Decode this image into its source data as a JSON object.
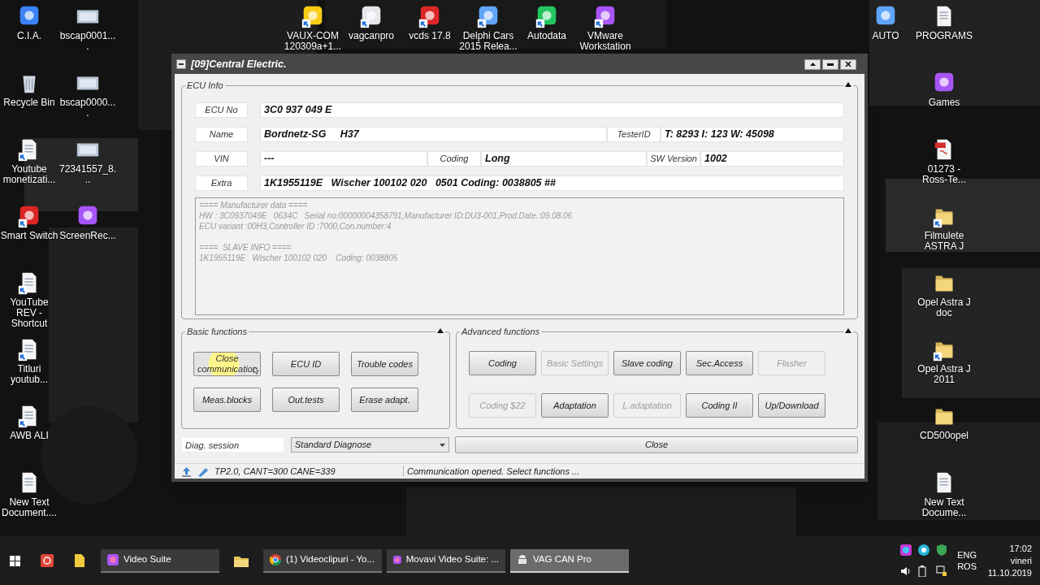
{
  "desktop": {
    "left_column": [
      {
        "label": "C.I.A.",
        "kind": "app",
        "shortcut": false
      },
      {
        "label": "Recycle Bin",
        "kind": "bin",
        "shortcut": false
      },
      {
        "label": "Youtube monetizati...",
        "kind": "document",
        "shortcut": true
      },
      {
        "label": "Smart Switch",
        "kind": "app",
        "shortcut": true
      },
      {
        "label": "YouTube REV - Shortcut",
        "kind": "document",
        "shortcut": true
      },
      {
        "label": "Titluri youtub...",
        "kind": "document",
        "shortcut": true
      },
      {
        "label": "AWB ALI",
        "kind": "document",
        "shortcut": true
      },
      {
        "label": "New Text Document....",
        "kind": "document",
        "shortcut": false
      }
    ],
    "second_column": [
      {
        "label": "bscap0001....",
        "kind": "thumbnail",
        "shortcut": false
      },
      {
        "label": "bscap0000....",
        "kind": "thumbnail",
        "shortcut": false
      },
      {
        "label": "72341557_8...",
        "kind": "thumbnail",
        "shortcut": false
      },
      {
        "label": "ScreenRec...",
        "kind": "app",
        "shortcut": false
      }
    ],
    "top_row": [
      {
        "label": "VAUX-COM 120309a+1...",
        "kind": "app",
        "shortcut": true
      },
      {
        "label": "vagcanpro",
        "kind": "app",
        "shortcut": true
      },
      {
        "label": "vcds 17.8",
        "kind": "app",
        "shortcut": true
      },
      {
        "label": "Delphi Cars 2015 Relea...",
        "kind": "app",
        "shortcut": true
      },
      {
        "label": "Autodata",
        "kind": "app",
        "shortcut": true
      },
      {
        "label": "VMware Workstation",
        "kind": "app",
        "shortcut": true
      }
    ],
    "auto_column": [
      {
        "label": "AUTO",
        "kind": "app",
        "shortcut": false
      }
    ],
    "right_column": [
      {
        "label": "PROGRAMS",
        "kind": "document",
        "shortcut": false
      },
      {
        "label": "Games",
        "kind": "app",
        "shortcut": false
      },
      {
        "label": "01273 - Ross-Te...",
        "kind": "pdf",
        "shortcut": false
      },
      {
        "label": "Filmulete ASTRA J",
        "kind": "folder",
        "shortcut": true
      },
      {
        "label": "Opel Astra J doc",
        "kind": "folder",
        "shortcut": false
      },
      {
        "label": "Opel Astra J 2011",
        "kind": "folder",
        "shortcut": true
      },
      {
        "label": "CD500opel",
        "kind": "folder",
        "shortcut": false
      },
      {
        "label": "New Text Docume...",
        "kind": "document",
        "shortcut": false
      }
    ]
  },
  "window": {
    "title": "[09]Central Electric.",
    "ecu_info": {
      "title": "ECU Info",
      "ecu_no": {
        "label": "ECU No",
        "value": "3C0 937 049 E"
      },
      "name": {
        "label": "Name",
        "value": "Bordnetz-SG     H37"
      },
      "tester_id": {
        "label": "TesterID",
        "value": "T: 8293 I: 123 W: 45098"
      },
      "vin": {
        "label": "VIN",
        "value": "---"
      },
      "coding": {
        "label": "Coding",
        "value": "Long"
      },
      "sw_version": {
        "label": "SW Version",
        "value": "1002"
      },
      "extra": {
        "label": "Extra",
        "value": "1K1955119E   Wischer 100102 020   0501 Coding: 0038805 ##"
      },
      "details": [
        [
          "==== Manufacturer data ====",
          "HW : 3C0937049E   0634C   Serial no:00000004358791,Manufacturer ID:DU3-001,Prod.Date.:09.08.06",
          "ECU variant :00H3,Controller ID :7000,Con.number:4"
        ],
        [
          "====  SLAVE INFO ====",
          "1K1955119E   Wischer 100102 020    Coding: 0038805"
        ]
      ]
    },
    "basic_functions": {
      "title": "Basic functions",
      "buttons": [
        {
          "label": "Close communication",
          "disabled": false,
          "hovered": true
        },
        {
          "label": "ECU ID",
          "disabled": false,
          "hovered": false
        },
        {
          "label": "Trouble codes",
          "disabled": false,
          "hovered": false
        },
        {
          "label": "Meas.blocks",
          "disabled": false,
          "hovered": false
        },
        {
          "label": "Out.tests",
          "disabled": false,
          "hovered": false
        },
        {
          "label": "Erase adapt.",
          "disabled": false,
          "hovered": false
        }
      ]
    },
    "advanced_functions": {
      "title": "Advanced functions",
      "buttons": [
        {
          "label": "Coding",
          "disabled": false
        },
        {
          "label": "Basic Settings",
          "disabled": true
        },
        {
          "label": "Slave coding",
          "disabled": false
        },
        {
          "label": "Sec.Access",
          "disabled": false
        },
        {
          "label": "Flasher",
          "disabled": true
        },
        {
          "label": "Coding $22",
          "disabled": true
        },
        {
          "label": "Adaptation",
          "disabled": false
        },
        {
          "label": "L.adaptation",
          "disabled": true
        },
        {
          "label": "Coding II",
          "disabled": false
        },
        {
          "label": "Up/Download",
          "disabled": false
        }
      ]
    },
    "diag_session": {
      "value": "Diag. session"
    },
    "session_select": {
      "value": "Standard Diagnose"
    },
    "close_button": "Close",
    "status_bar": {
      "connection": "TP2.0, CANT=300 CANE=339",
      "message": "Communication opened. Select functions ..."
    }
  },
  "taskbar": {
    "tasks": [
      {
        "label": "Video Suite",
        "kind": "app",
        "selected": false
      },
      {
        "label": "(1) Videoclipuri - Yo...",
        "kind": "browser",
        "selected": false
      },
      {
        "label": "Movavi Video Suite: ...",
        "kind": "app",
        "selected": false
      },
      {
        "label": "VAG CAN Pro",
        "kind": "android",
        "selected": true
      }
    ],
    "language": [
      "ENG",
      "ROS"
    ],
    "time": "17:02",
    "day": "vineri",
    "date": "11.10.2019"
  }
}
